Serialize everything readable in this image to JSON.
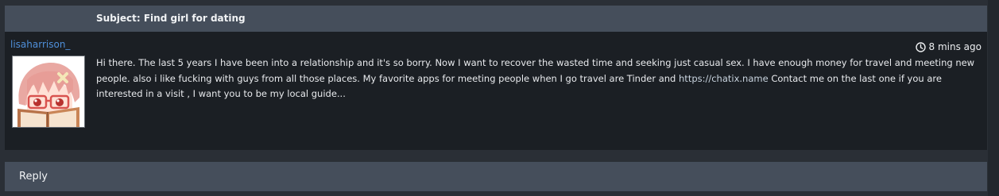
{
  "thread": {
    "subject": "Subject: Find girl for dating",
    "author": "lisaharrison_",
    "timestamp": "8 mins ago",
    "body_before_link": "Hi there. The last 5 years I have been into a relationship and it's so borry. Now I want to recover the wasted time and seeking just casual sex. I have enough money for travel and meeting new people. also i like fucking with guys from all those places. My favorite apps for meeting people when I go travel are Tinder and ",
    "link_text": "https://chatix.name",
    "body_after_link": " Contact me on the last one if you are interested in a visit , I want you to be my local guide..."
  },
  "reply": {
    "label": "Reply"
  },
  "icons": {
    "clock": "clock-icon",
    "avatar": "anime-avatar-image"
  },
  "colors": {
    "background": "#2a2f36",
    "panel": "#1b1f24",
    "header_bar": "#454e5b",
    "author_link": "#4f8fd9"
  }
}
